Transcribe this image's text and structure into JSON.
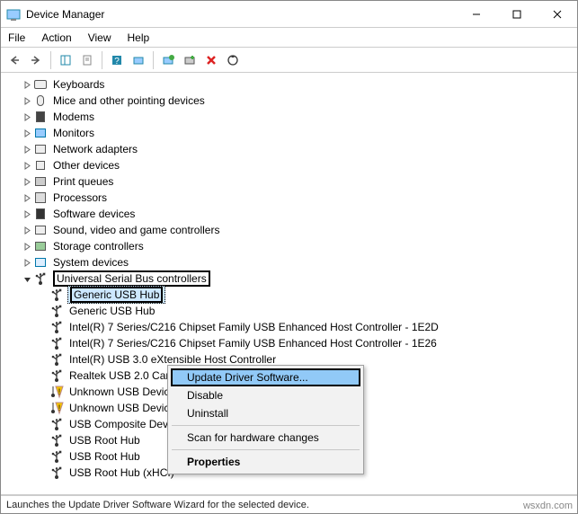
{
  "window": {
    "title": "Device Manager"
  },
  "menu": {
    "file": "File",
    "action": "Action",
    "view": "View",
    "help": "Help"
  },
  "tree": {
    "nodes": [
      {
        "label": "Keyboards",
        "icon": "keyboard"
      },
      {
        "label": "Mice and other pointing devices",
        "icon": "mouse"
      },
      {
        "label": "Modems",
        "icon": "modem"
      },
      {
        "label": "Monitors",
        "icon": "monitor"
      },
      {
        "label": "Network adapters",
        "icon": "network"
      },
      {
        "label": "Other devices",
        "icon": "other"
      },
      {
        "label": "Print queues",
        "icon": "print"
      },
      {
        "label": "Processors",
        "icon": "cpu"
      },
      {
        "label": "Software devices",
        "icon": "software"
      },
      {
        "label": "Sound, video and game controllers",
        "icon": "sound"
      },
      {
        "label": "Storage controllers",
        "icon": "storage"
      },
      {
        "label": "System devices",
        "icon": "system"
      },
      {
        "label": "Universal Serial Bus controllers",
        "icon": "usb",
        "expanded": true
      }
    ],
    "usbChildren": [
      {
        "label": "Generic USB Hub",
        "icon": "usb",
        "selected": true
      },
      {
        "label": "Generic USB Hub",
        "icon": "usb"
      },
      {
        "label": "Intel(R) 7 Series/C216 Chipset Family USB Enhanced Host Controller - 1E2D",
        "icon": "usb"
      },
      {
        "label": "Intel(R) 7 Series/C216 Chipset Family USB Enhanced Host Controller - 1E26",
        "icon": "usb"
      },
      {
        "label": "Intel(R) USB 3.0 eXtensible Host Controller",
        "icon": "usb"
      },
      {
        "label": "Realtek USB 2.0 Card Reader",
        "icon": "usb"
      },
      {
        "label": "Unknown USB Device",
        "icon": "warn"
      },
      {
        "label": "Unknown USB Device",
        "icon": "warn"
      },
      {
        "label": "USB Composite Device",
        "icon": "usb"
      },
      {
        "label": "USB Root Hub",
        "icon": "usb"
      },
      {
        "label": "USB Root Hub",
        "icon": "usb"
      },
      {
        "label": "USB Root Hub (xHCI)",
        "icon": "usb"
      }
    ]
  },
  "context": {
    "update": "Update Driver Software...",
    "disable": "Disable",
    "uninstall": "Uninstall",
    "scan": "Scan for hardware changes",
    "properties": "Properties"
  },
  "status": "Launches the Update Driver Software Wizard for the selected device.",
  "watermark": "wsxdn.com"
}
